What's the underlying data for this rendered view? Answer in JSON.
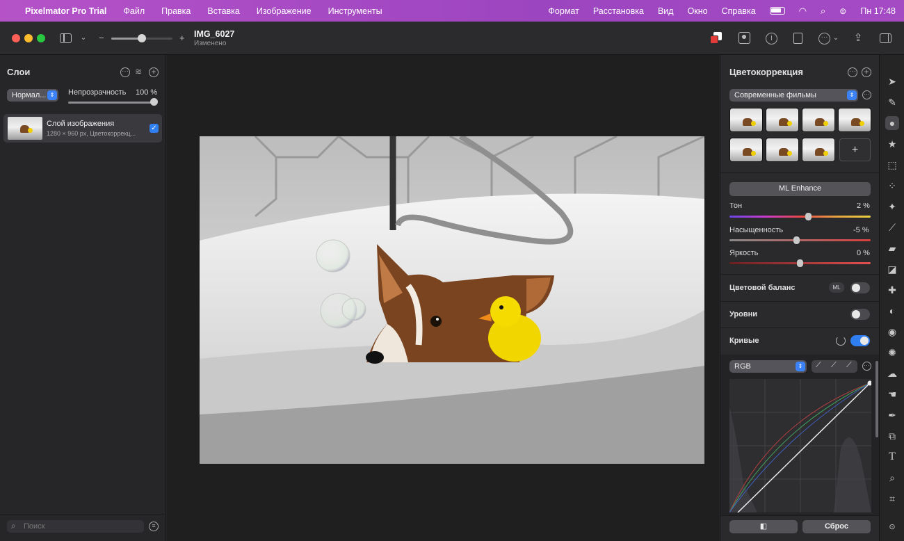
{
  "menubar": {
    "app_name": "Pixelmator Pro Trial",
    "menus": [
      "Файл",
      "Правка",
      "Вставка",
      "Изображение",
      "Инструменты"
    ],
    "right_menus": [
      "Формат",
      "Расстановка",
      "Вид",
      "Окно",
      "Справка"
    ],
    "clock": "Пн 17:48"
  },
  "toolbar": {
    "doc_title": "IMG_6027",
    "doc_status": "Изменено",
    "zoom_minus": "−",
    "zoom_plus": "+"
  },
  "layers": {
    "title": "Слои",
    "blend_mode": "Нормал...",
    "opacity_label": "Непрозрачность",
    "opacity_value": "100 %",
    "layer_name": "Слой изображения",
    "layer_info": "1280 × 960 px, Цветокоррекц...",
    "search_placeholder": "Поиск"
  },
  "color_adjust": {
    "title": "Цветокоррекция",
    "preset_select": "Современные фильмы",
    "add_preset": "+",
    "ml_enhance": "ML Enhance",
    "hue_label": "Тон",
    "hue_value": "2 %",
    "saturation_label": "Насыщенность",
    "saturation_value": "-5 %",
    "brightness_label": "Яркость",
    "brightness_value": "0 %",
    "color_balance_label": "Цветовой баланс",
    "ml_badge": "ML",
    "levels_label": "Уровни",
    "curves_label": "Кривые",
    "curves_channel": "RGB",
    "compare_label": "◧",
    "reset_label": "Сброс"
  },
  "colors": {
    "accent": "#2f7ff0",
    "menubar": "#a44bc4"
  }
}
